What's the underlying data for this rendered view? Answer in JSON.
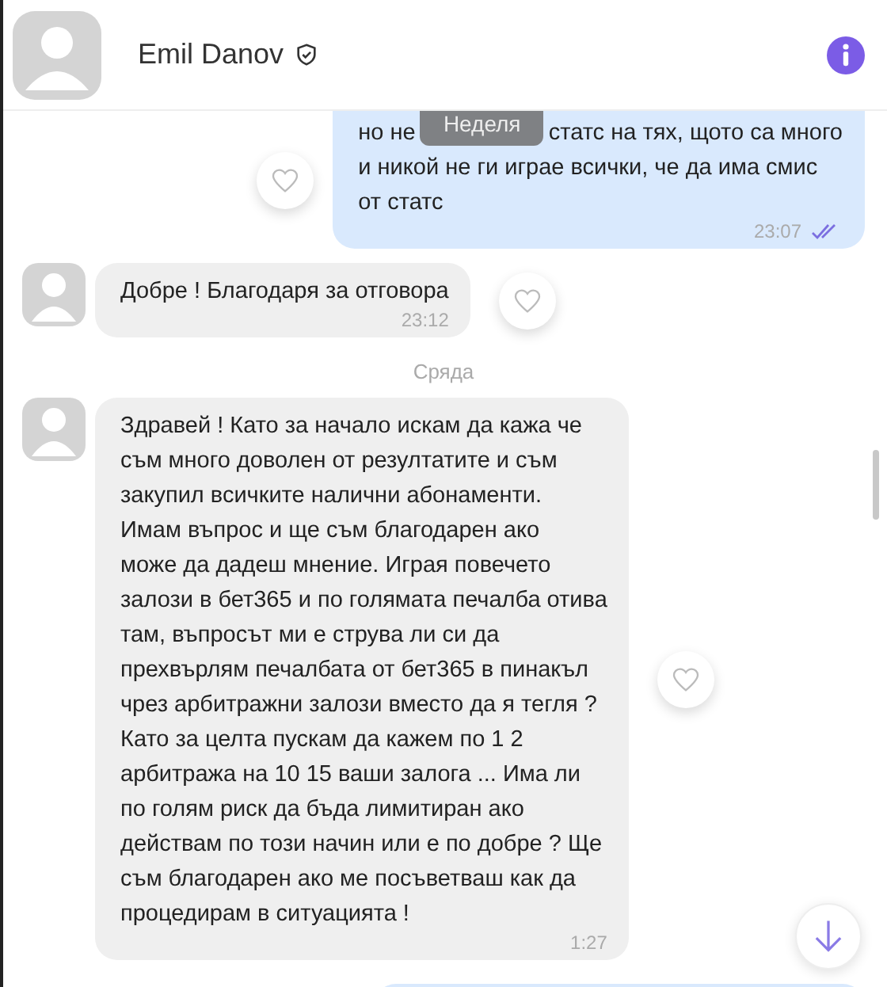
{
  "header": {
    "name": "Emil Danov"
  },
  "floating_date": "Неделя",
  "messages": [
    {
      "kind": "outgoing",
      "covered_line": [
        "но не",
        "статс на тях, щото са много"
      ],
      "lines": [
        "и никой не ги играе всички, че да има смис",
        "от статс"
      ],
      "time": "23:07",
      "read": true
    },
    {
      "kind": "incoming",
      "lines": [
        "Добре ! Благодаря за отговора"
      ],
      "time": "23:12"
    },
    {
      "kind": "date",
      "label": "Сряда"
    },
    {
      "kind": "incoming",
      "lines": [
        "Здравей ! Като за начало искам да кажа че",
        "съм много доволен от резултатите и съм",
        "закупил всичките налични абонаменти.",
        "Имам въпрос и ще съм благодарен ако",
        "може да дадеш мнение. Играя повечето",
        "залози в бет365 и по голямата печалба отива",
        "там, въпросът ми е струва ли си да",
        "прехвърлям печалбата от бет365 в пинакъл",
        "чрез арбитражни залози вместо да я тегля ?",
        "Като за целта пускам да кажем по 1 2",
        "арбитража на 10 15 ваши залога ...  Има ли",
        "по голям риск да бъда лимитиран ако",
        "действам по този начин или е по добре ? Ще",
        "съм благодарен ако ме посъветваш как да",
        "процедирам в ситуацията !"
      ],
      "time": "1:27"
    },
    {
      "kind": "partial"
    }
  ]
}
